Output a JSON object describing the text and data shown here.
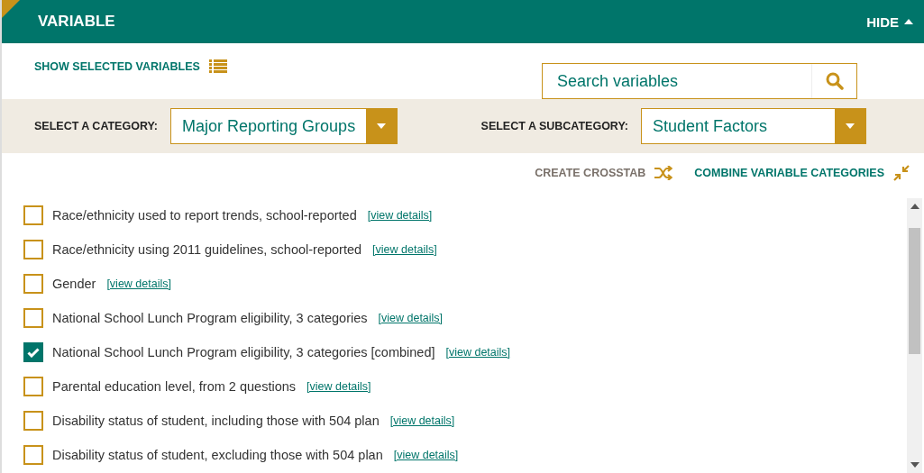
{
  "header": {
    "title": "VARIABLE",
    "toggle": "HIDE"
  },
  "show_selected": "SHOW SELECTED VARIABLES",
  "search": {
    "placeholder": "Search variables"
  },
  "category": {
    "label": "SELECT A CATEGORY:",
    "value": "Major Reporting Groups"
  },
  "subcategory": {
    "label": "SELECT A SUBCATEGORY:",
    "value": "Student Factors"
  },
  "actions": [
    {
      "label": "CREATE CROSSTAB",
      "kind": "crosstab",
      "disabled": true
    },
    {
      "label": "COMBINE VARIABLE CATEGORIES",
      "kind": "combine",
      "disabled": false
    }
  ],
  "variables": [
    {
      "name": "Race/ethnicity used to report trends, school-reported",
      "link": "[view details]",
      "checked": false
    },
    {
      "name": "Race/ethnicity using 2011 guidelines, school-reported",
      "link": "[view details]",
      "checked": false
    },
    {
      "name": "Gender",
      "link": "[view details]",
      "checked": false
    },
    {
      "name": "National School Lunch Program eligibility, 3 categories",
      "link": "[view details]",
      "checked": false
    },
    {
      "name": "National School Lunch Program eligibility, 3 categories [combined]",
      "link": "[view details]",
      "checked": true
    },
    {
      "name": "Parental education level, from 2 questions",
      "link": "[view details]",
      "checked": false
    },
    {
      "name": "Disability status of student, including those with 504 plan",
      "link": "[view details]",
      "checked": false
    },
    {
      "name": "Disability status of student, excluding those with 504 plan",
      "link": "[view details]",
      "checked": false
    }
  ]
}
